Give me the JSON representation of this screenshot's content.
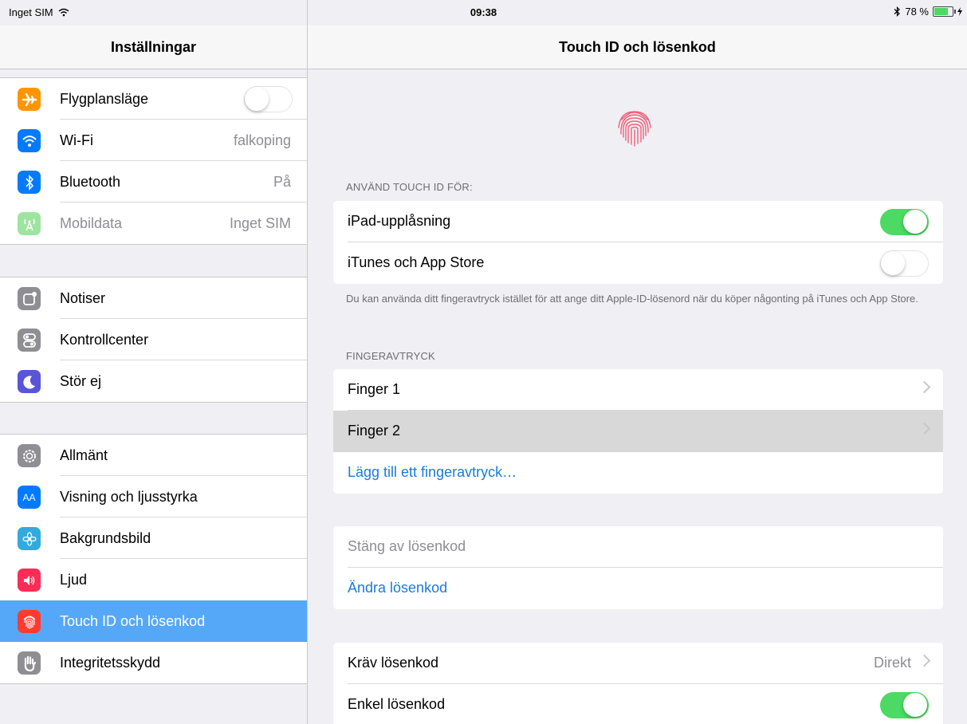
{
  "status_bar": {
    "carrier": "Inget SIM",
    "time": "09:38",
    "battery_percent": "78 %",
    "battery_level": 0.78
  },
  "sidebar": {
    "title": "Inställningar",
    "groups": [
      [
        {
          "label": "Flygplansläge",
          "icon": "airplane-icon",
          "color": "#ff9500",
          "toggle": false
        },
        {
          "label": "Wi-Fi",
          "value": "falkoping",
          "icon": "wifi-icon",
          "color": "#007aff"
        },
        {
          "label": "Bluetooth",
          "value": "På",
          "icon": "bluetooth-icon",
          "color": "#007aff"
        },
        {
          "label": "Mobildata",
          "value": "Inget SIM",
          "icon": "cellular-icon",
          "color": "#9de4a1"
        }
      ],
      [
        {
          "label": "Notiser",
          "icon": "notifications-icon",
          "color": "#8e8e93"
        },
        {
          "label": "Kontrollcenter",
          "icon": "control-center-icon",
          "color": "#8e8e93"
        },
        {
          "label": "Stör ej",
          "icon": "moon-icon",
          "color": "#5856d6"
        }
      ],
      [
        {
          "label": "Allmänt",
          "icon": "gear-icon",
          "color": "#8e8e93"
        },
        {
          "label": "Visning och ljusstyrka",
          "icon": "display-icon",
          "color": "#007aff",
          "glyph": "AA"
        },
        {
          "label": "Bakgrundsbild",
          "icon": "wallpaper-icon",
          "color": "#34aadc"
        },
        {
          "label": "Ljud",
          "icon": "speaker-icon",
          "color": "#ff2d55"
        },
        {
          "label": "Touch ID och lösenkod",
          "icon": "fingerprint-icon",
          "color": "#ff3b30",
          "selected": true
        },
        {
          "label": "Integritetsskydd",
          "icon": "hand-icon",
          "color": "#8e8e93"
        }
      ]
    ]
  },
  "detail": {
    "title": "Touch ID och lösenkod",
    "use_touch_id_header": "ANVÄND TOUCH ID FÖR:",
    "ipad_unlock_label": "iPad-upplåsning",
    "ipad_unlock_on": true,
    "itunes_label": "iTunes och App Store",
    "itunes_on": false,
    "itunes_note": "Du kan använda ditt fingeravtryck istället för att ange ditt Apple-ID-lösenord när du köper någonting på iTunes och App Store.",
    "fingerprints_header": "FINGERAVTRYCK",
    "finger1_label": "Finger 1",
    "finger2_label": "Finger 2",
    "add_fingerprint_label": "Lägg till ett fingeravtryck…",
    "turn_off_passcode_label": "Stäng av lösenkod",
    "change_passcode_label": "Ändra lösenkod",
    "require_passcode_label": "Kräv lösenkod",
    "require_passcode_value": "Direkt",
    "simple_passcode_label": "Enkel lösenkod",
    "simple_passcode_on": true
  }
}
